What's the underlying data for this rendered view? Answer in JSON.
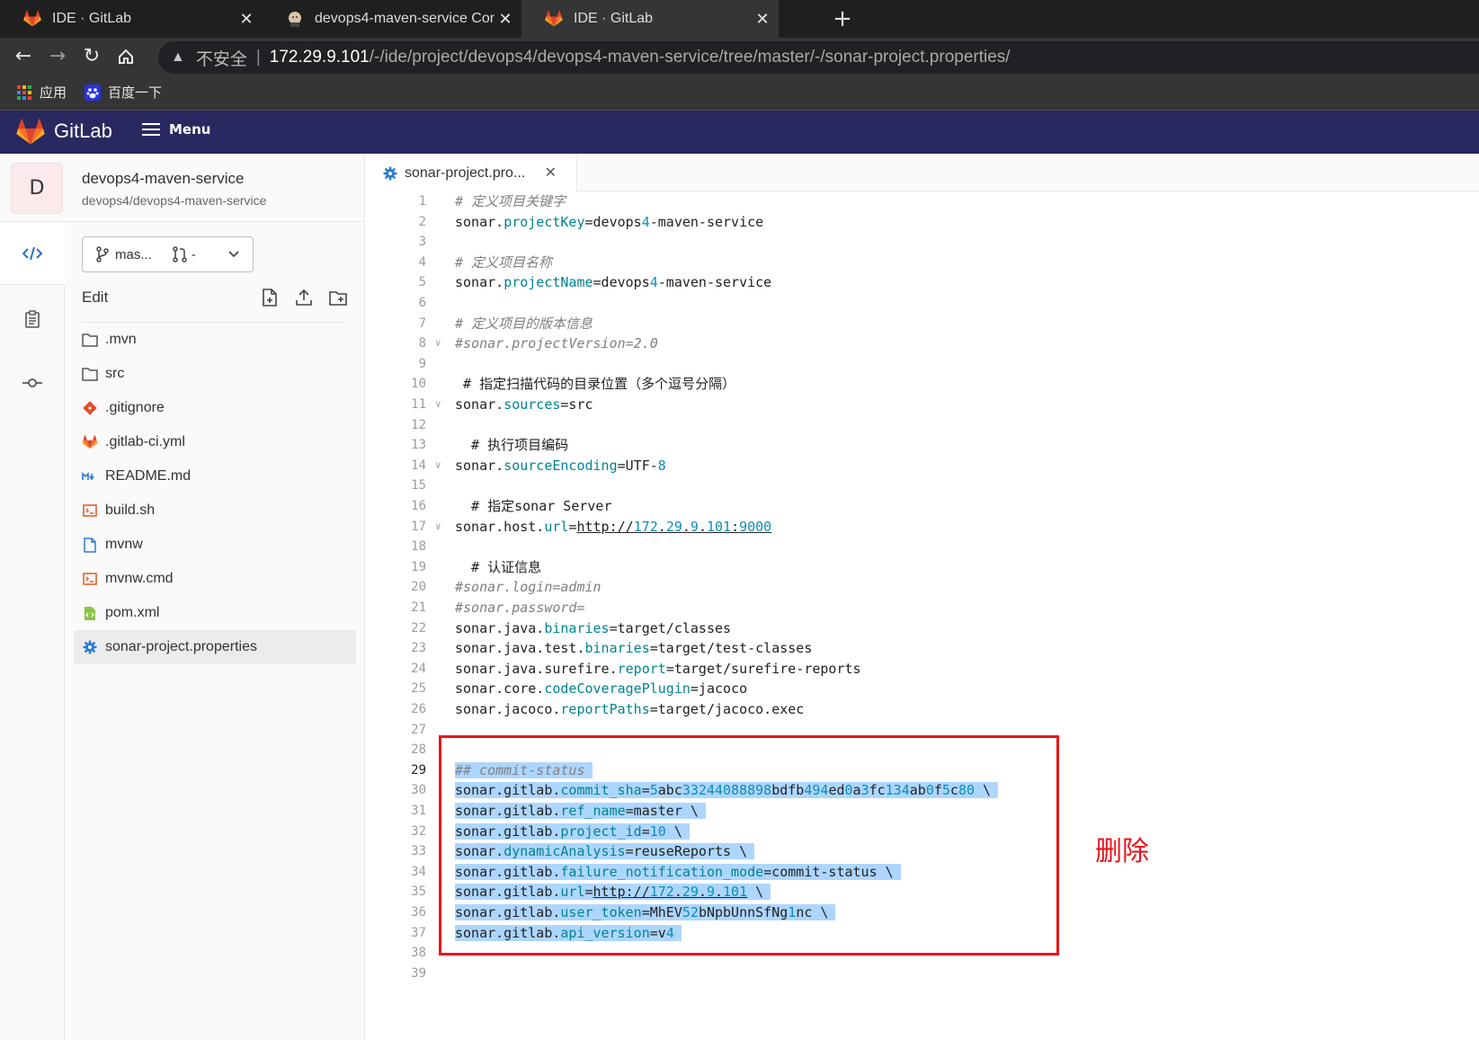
{
  "browser": {
    "tabs": [
      {
        "title": "IDE · GitLab",
        "active": false
      },
      {
        "title": "devops4-maven-service Config",
        "active": false
      },
      {
        "title": "IDE · GitLab",
        "active": true
      }
    ],
    "address": {
      "security": "不安全",
      "host": "172.29.9.101",
      "path": "/-/ide/project/devops4/devops4-maven-service/tree/master/-/sonar-project.properties/"
    },
    "bookmarks": [
      {
        "label": "应用",
        "icon": "apps-grid-icon"
      },
      {
        "label": "百度一下",
        "icon": "baidu-paw-icon"
      }
    ]
  },
  "gitlab": {
    "brand": "GitLab",
    "menu_label": "Menu",
    "colors": {
      "header": "#292961",
      "accent": "#fc6d26"
    }
  },
  "project": {
    "avatar_letter": "D",
    "name": "devops4-maven-service",
    "path": "devops4/devops4-maven-service",
    "branch": "mas...",
    "mr": "-"
  },
  "filetree": {
    "edit_label": "Edit",
    "files": [
      {
        "name": ".mvn",
        "icon": "folder-icon"
      },
      {
        "name": "src",
        "icon": "folder-icon"
      },
      {
        "name": ".gitignore",
        "icon": "git-icon"
      },
      {
        "name": ".gitlab-ci.yml",
        "icon": "gitlab-icon"
      },
      {
        "name": "README.md",
        "icon": "markdown-icon"
      },
      {
        "name": "build.sh",
        "icon": "terminal-icon"
      },
      {
        "name": "mvnw",
        "icon": "file-icon"
      },
      {
        "name": "mvnw.cmd",
        "icon": "terminal-icon"
      },
      {
        "name": "pom.xml",
        "icon": "xml-icon"
      },
      {
        "name": "sonar-project.properties",
        "icon": "gear-icon",
        "active": true
      }
    ]
  },
  "editor": {
    "tab_title": "sonar-project.pro...",
    "current_line": 29
  },
  "annotation": {
    "label": "删除",
    "color": "#e8141b"
  }
}
